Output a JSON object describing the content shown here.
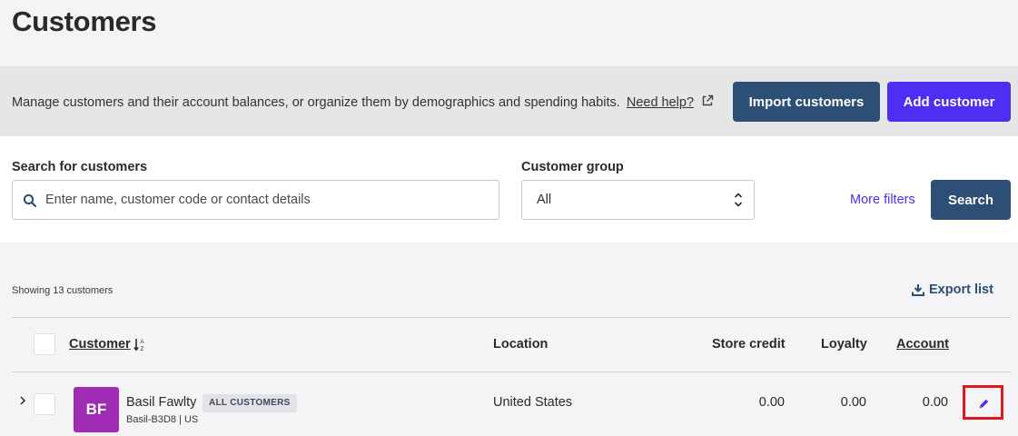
{
  "page": {
    "title": "Customers"
  },
  "banner": {
    "description": "Manage customers and their account balances, or organize them by demographics and spending habits.",
    "help_link": "Need help?",
    "import_label": "Import customers",
    "add_label": "Add customer"
  },
  "filters": {
    "search_label": "Search for customers",
    "search_placeholder": "Enter name, customer code or contact details",
    "group_label": "Customer group",
    "group_value": "All",
    "more_filters": "More filters",
    "search_button": "Search"
  },
  "list": {
    "count_text": "Showing 13 customers",
    "export_label": "Export list",
    "columns": {
      "customer": "Customer",
      "location": "Location",
      "store_credit": "Store credit",
      "loyalty": "Loyalty",
      "account": "Account"
    },
    "rows": [
      {
        "initials": "BF",
        "name": "Basil Fawlty",
        "group_badge": "ALL CUSTOMERS",
        "code": "Basil-B3D8 | US",
        "location": "United States",
        "store_credit": "0.00",
        "loyalty": "0.00",
        "account": "0.00",
        "avatar_color": "#a02bb4"
      }
    ]
  },
  "colors": {
    "primary_dark": "#2d4e75",
    "accent": "#4c2ff2",
    "highlight": "#e2161d"
  },
  "icons": {
    "external_link": "external-link-icon",
    "search": "search-icon",
    "select": "select-arrows-icon",
    "export": "download-icon",
    "sort": "sort-alpha-icon",
    "expand": "chevron-right-icon",
    "edit": "pencil-icon"
  }
}
